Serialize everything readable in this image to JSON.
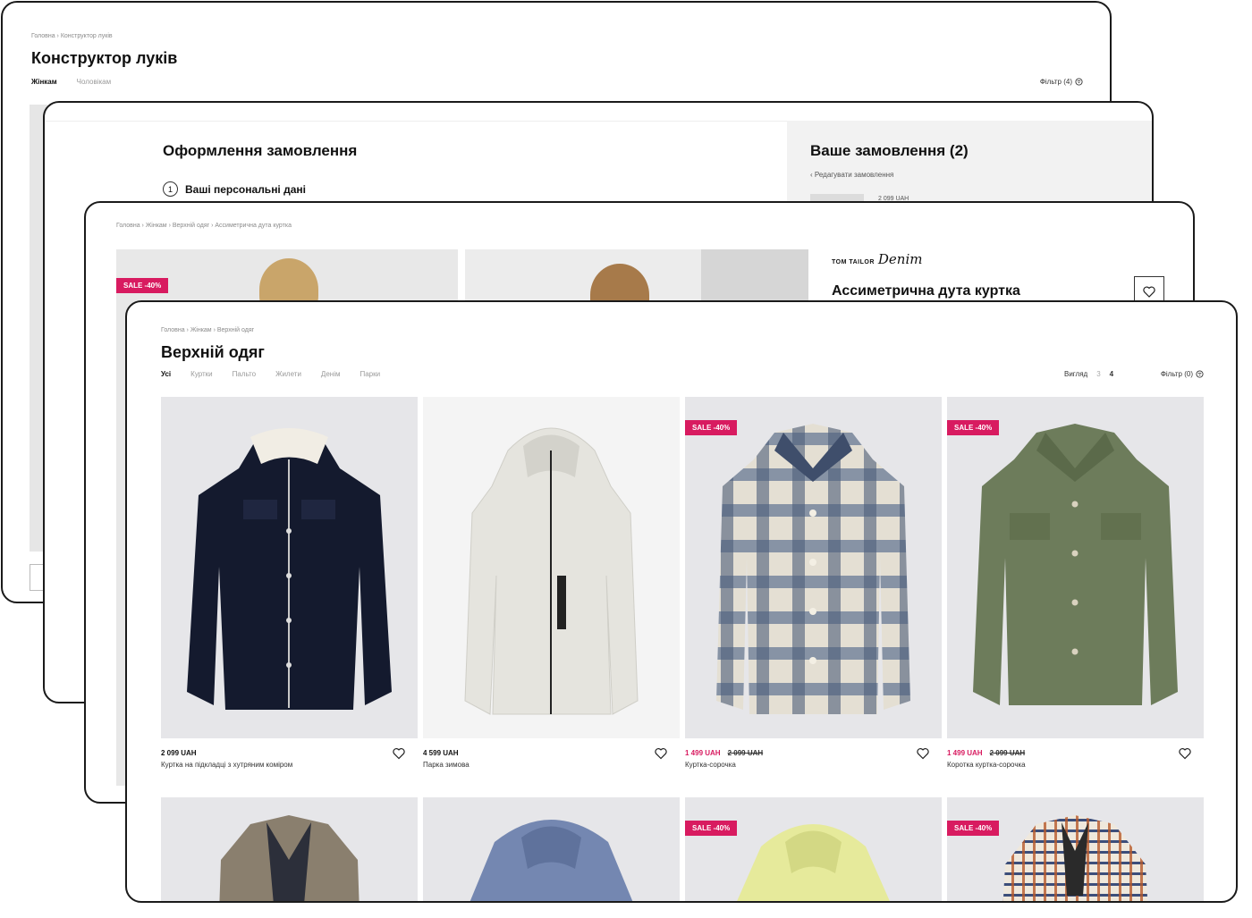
{
  "looks": {
    "breadcrumb": "Головна › Конструктор луків",
    "title": "Конструктор луків",
    "tabs": [
      "Жінкам",
      "Чоловікам"
    ],
    "filter": "Фільтр (4)"
  },
  "checkout": {
    "title": "Оформлення замовлення",
    "step_number": "1",
    "step_label": "Ваші персональні дані",
    "summary_title": "Ваше замовлення (2)",
    "edit_link": "‹ Редагувати замовлення",
    "summary_price": "2 099 UAH"
  },
  "product": {
    "breadcrumb": "Головна › Жінкам › Верхній одяг › Ассиметрична дута куртка",
    "badge": "SALE -40%",
    "brand_a": "TOM TAILOR",
    "brand_b": "Denim",
    "name": "Ассиметрична дута куртка"
  },
  "catalog": {
    "breadcrumb": "Головна › Жінкам › Верхній одяг",
    "title": "Верхній одяг",
    "tabs": [
      "Усі",
      "Куртки",
      "Пальто",
      "Жилети",
      "Денім",
      "Парки"
    ],
    "view_label": "Вигляд",
    "view_options": [
      "3",
      "4"
    ],
    "filter": "Фільтр (0)",
    "sale_badge": "SALE -40%",
    "products": [
      {
        "price": "2 099 UAH",
        "old_price": "",
        "name": "Куртка на підкладці з хутряним коміром"
      },
      {
        "price": "4 599 UAH",
        "old_price": "",
        "name": "Парка зимова"
      },
      {
        "price": "1 499 UAH",
        "old_price": "2 099 UAH",
        "name": "Куртка-сорочка"
      },
      {
        "price": "1 499 UAH",
        "old_price": "2 099 UAH",
        "name": "Коротка куртка-сорочка"
      }
    ]
  },
  "colors": {
    "sale": "#d81b60",
    "border": "#1a1a1a"
  }
}
